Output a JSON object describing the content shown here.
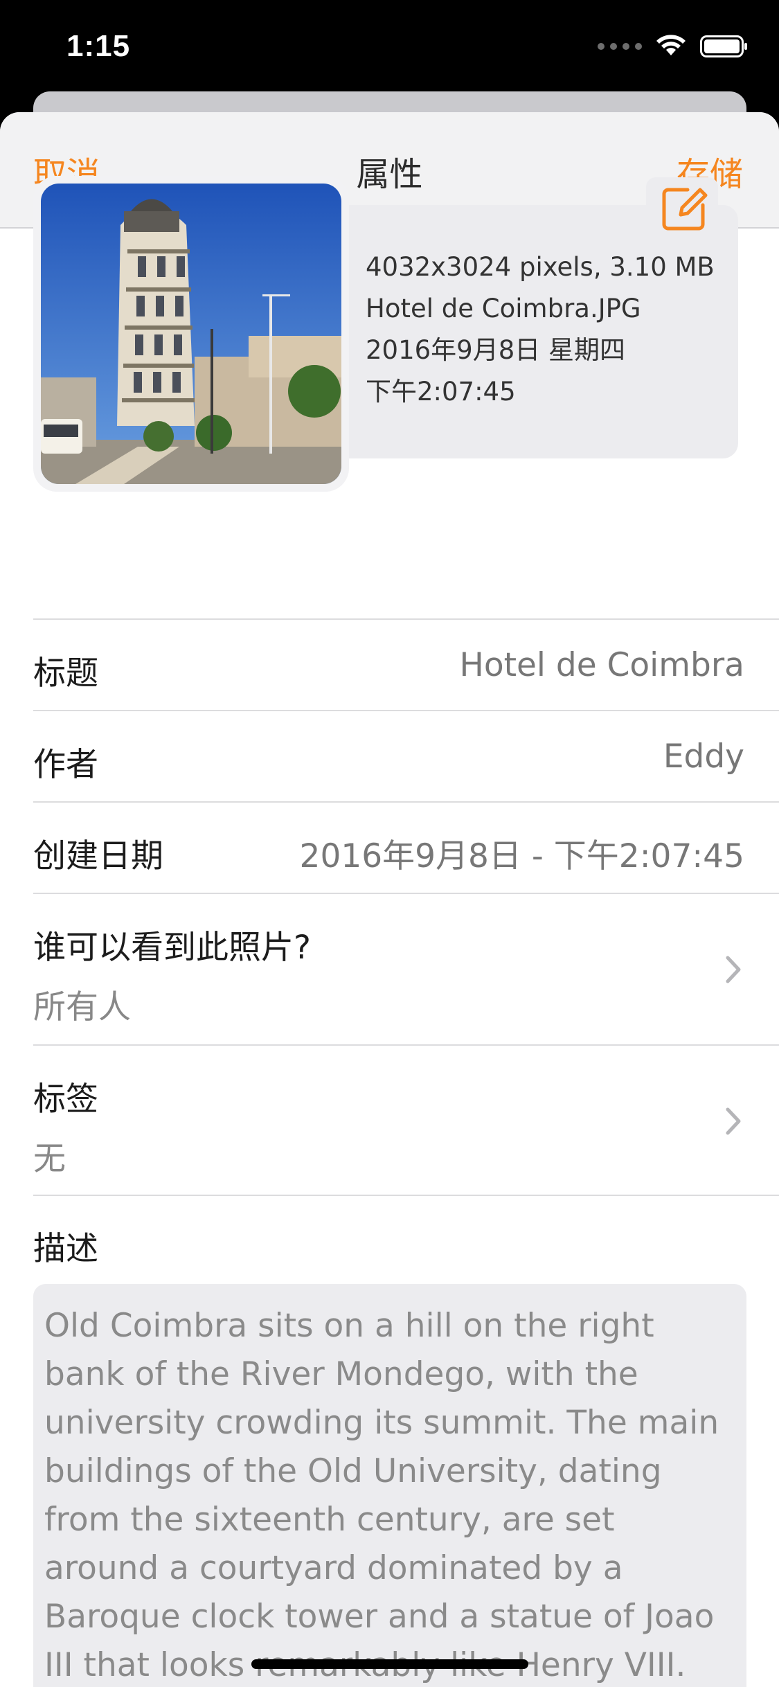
{
  "status_bar": {
    "time": "1:15",
    "icons": [
      "signal-icon",
      "wifi-icon",
      "battery-icon"
    ]
  },
  "nav": {
    "cancel_label": "取消",
    "title": "属性",
    "save_label": "存储",
    "accent_color": "#f5861f"
  },
  "photo_info": {
    "dimensions_size": "4032x3024 pixels, 3.10 MB",
    "filename": "Hotel de Coimbra.JPG",
    "date": "2016年9月8日 星期四",
    "time": "下午2:07:45",
    "edit_icon": "edit-icon"
  },
  "fields": {
    "title_label": "标题",
    "title_value": "Hotel de Coimbra",
    "author_label": "作者",
    "author_value": "Eddy",
    "created_label": "创建日期",
    "created_value": "2016年9月8日 - 下午2:07:45",
    "visibility_label": "谁可以看到此照片?",
    "visibility_value": "所有人",
    "tags_label": "标签",
    "tags_value": "无"
  },
  "description": {
    "label": "描述",
    "text": "Old Coimbra sits on a hill on the right bank of the River Mondego, with the university crowding its summit. The main buildings of the Old University, dating from the sixteenth century, are set around a courtyard dominated by a Baroque clock tower and a statue of Joao III that looks remarkably like Henry VIII."
  }
}
